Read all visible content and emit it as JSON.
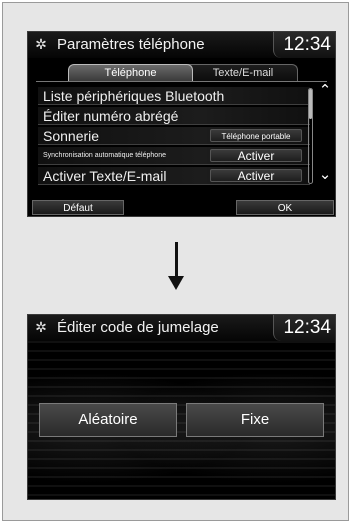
{
  "screen1": {
    "title": "Paramètres téléphone",
    "clock": "12:34",
    "tabs": [
      {
        "label": "Téléphone",
        "active": true
      },
      {
        "label": "Texte/E-mail",
        "active": false
      }
    ],
    "rows": [
      {
        "label": "Liste périphériques Bluetooth",
        "value": ""
      },
      {
        "label": "Éditer numéro abrégé",
        "value": ""
      },
      {
        "label": "Sonnerie",
        "value": "Téléphone portable"
      },
      {
        "label": "Synchronisation automatique téléphone",
        "value": "Activer"
      },
      {
        "label": "Activer Texte/E-mail",
        "value": "Activer"
      }
    ],
    "buttons": {
      "default": "Défaut",
      "ok": "OK"
    },
    "icons": {
      "settings": "gear-icon",
      "scroll_up": "chevron-up-icon",
      "scroll_down": "chevron-down-icon"
    }
  },
  "screen2": {
    "title": "Éditer code de jumelage",
    "clock": "12:34",
    "buttons": {
      "random": "Aléatoire",
      "fixed": "Fixe"
    }
  },
  "colors": {
    "screen_bg": "#000000",
    "page_bg": "#e6e6e6",
    "text": "#ffffff"
  }
}
